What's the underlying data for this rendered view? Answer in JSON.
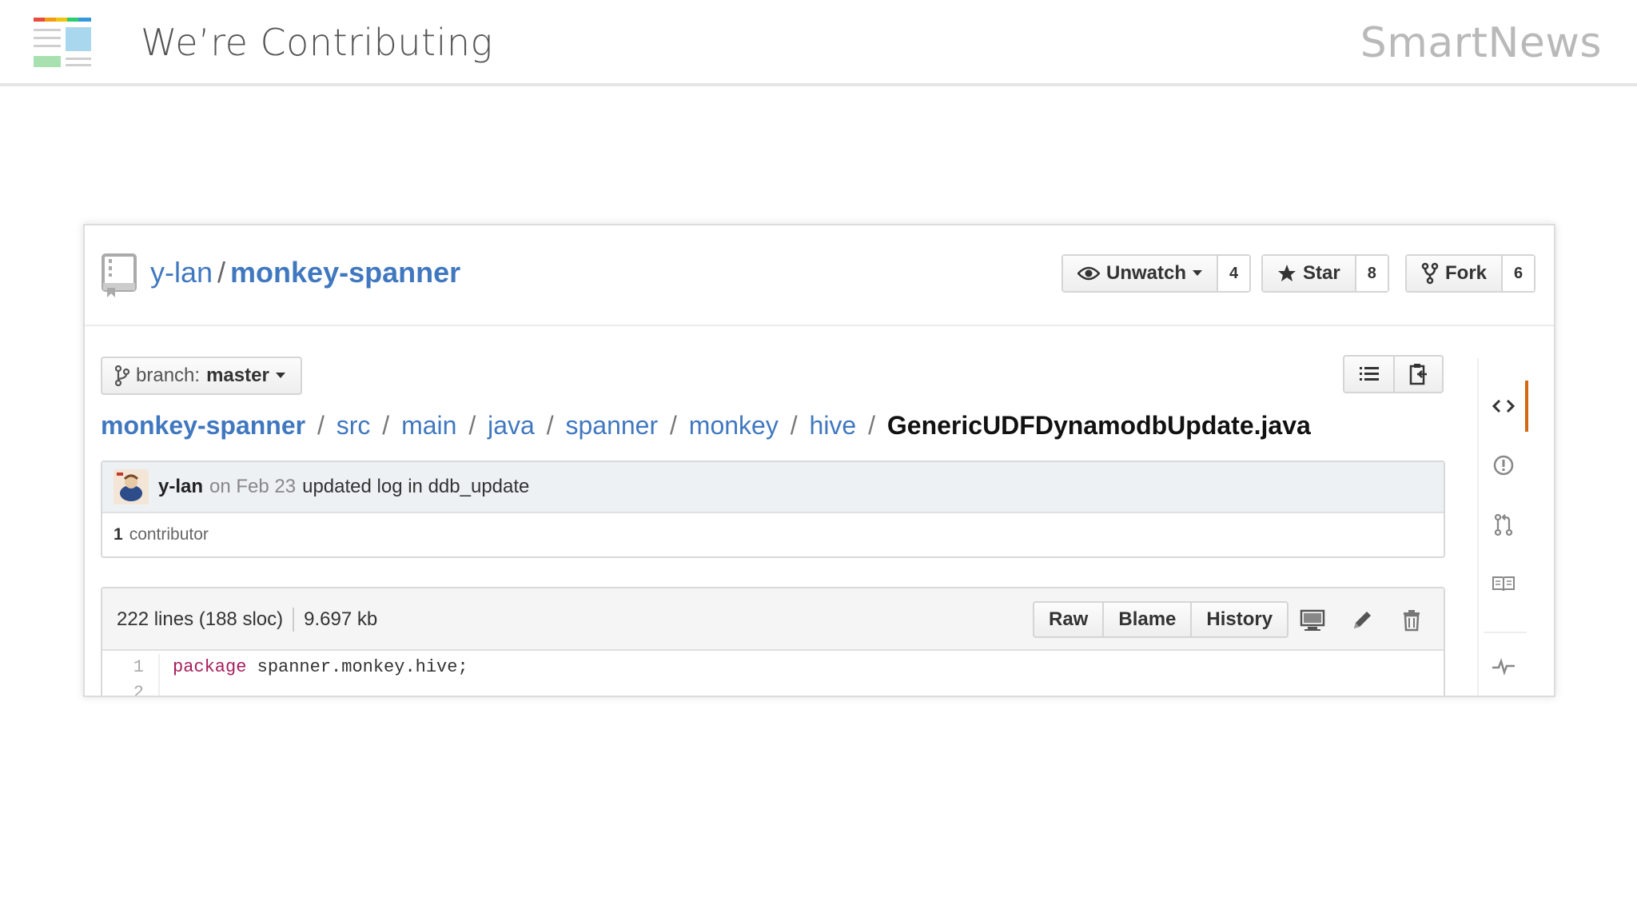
{
  "slide": {
    "title": "We’re Contributing",
    "brand": "SmartNews"
  },
  "repo": {
    "owner": "y-lan",
    "separator": "/",
    "name": "monkey-spanner"
  },
  "social": {
    "watch": {
      "label": "Unwatch",
      "count": "4"
    },
    "star": {
      "label": "Star",
      "count": "8"
    },
    "fork": {
      "label": "Fork",
      "count": "6"
    }
  },
  "branch": {
    "prefix": "branch:",
    "name": "master"
  },
  "breadcrumb": {
    "root": "monkey-spanner",
    "sep": "/",
    "parts": [
      "src",
      "main",
      "java",
      "spanner",
      "monkey",
      "hive"
    ],
    "file": "GenericUDFDynamodbUpdate.java"
  },
  "commit": {
    "author": "y-lan",
    "date": "on Feb 23",
    "message": "updated log in ddb_update",
    "contributors_count": "1",
    "contributors_label": "contributor"
  },
  "file": {
    "lines": "222 lines (188 sloc)",
    "size": "9.697 kb",
    "actions": {
      "raw": "Raw",
      "blame": "Blame",
      "history": "History"
    }
  },
  "code": [
    {
      "num": "1",
      "keyword": "package",
      "text": " spanner.monkey.hive;"
    },
    {
      "num": "2",
      "keyword": "",
      "text": ""
    }
  ],
  "colors": {
    "link": "#4078c0",
    "accent": "#d26911",
    "keyword": "#a71d5d"
  }
}
